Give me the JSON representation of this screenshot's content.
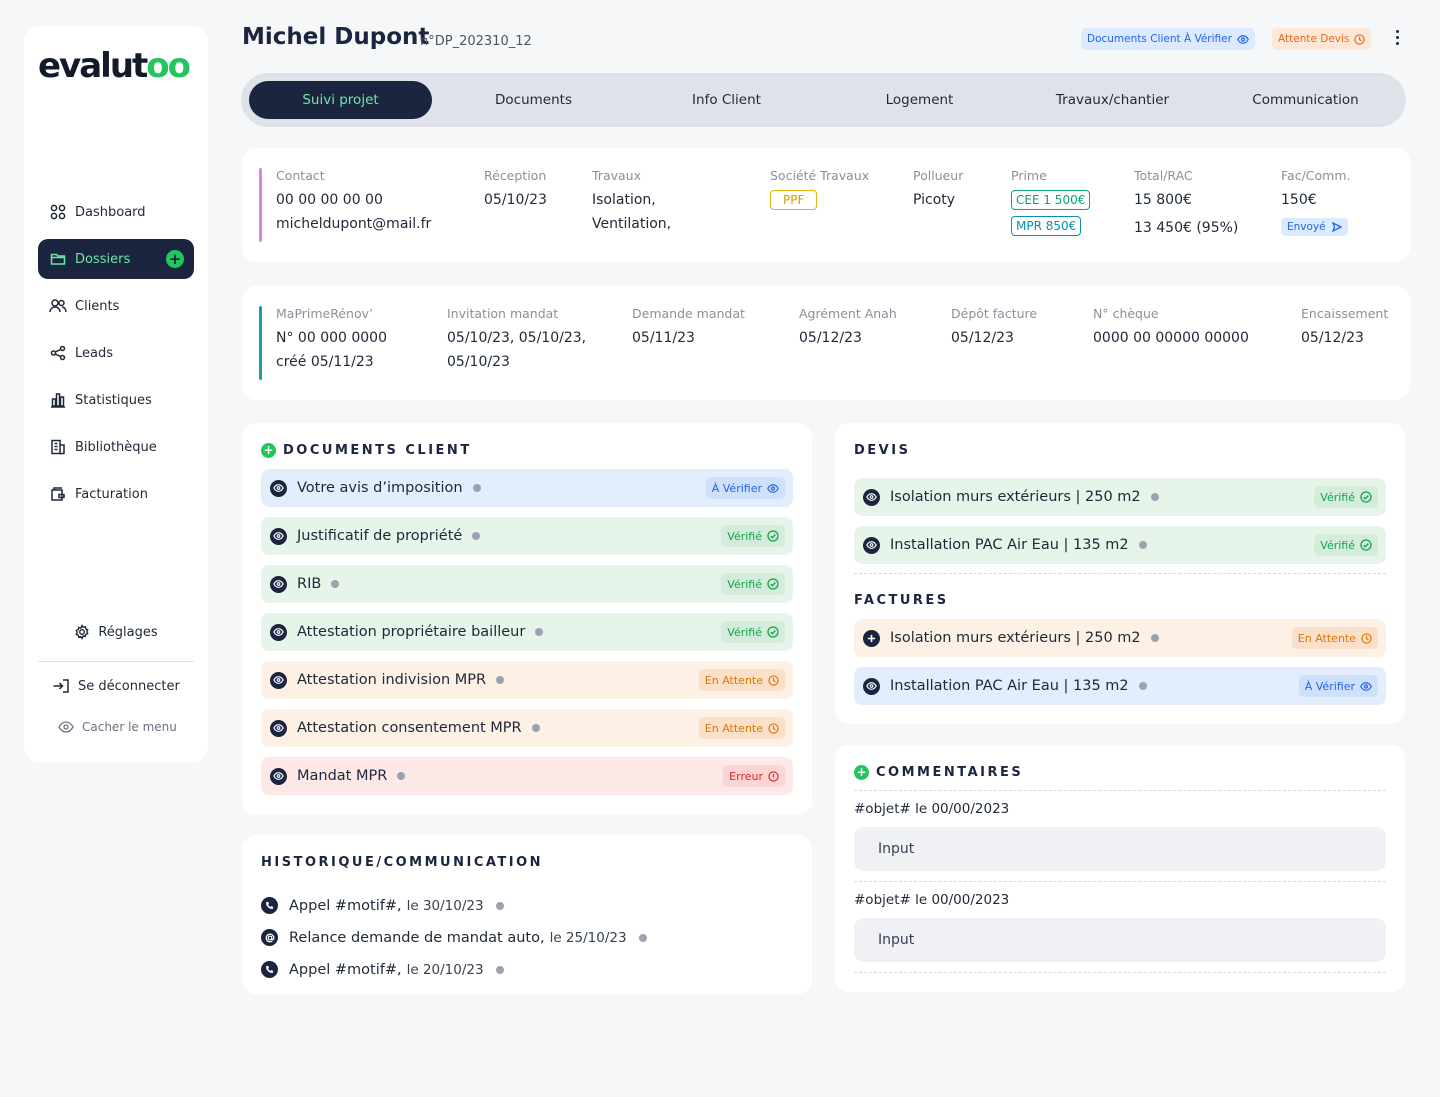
{
  "sidebar": {
    "logo_main": "evalut",
    "logo_accent": "oo",
    "items": [
      {
        "label": "Dashboard",
        "icon": "grid-icon"
      },
      {
        "label": "Dossiers",
        "icon": "folder-icon"
      },
      {
        "label": "Clients",
        "icon": "users-icon"
      },
      {
        "label": "Leads",
        "icon": "share-icon"
      },
      {
        "label": "Statistiques",
        "icon": "bar-chart-icon"
      },
      {
        "label": "Bibliothèque",
        "icon": "building-icon"
      },
      {
        "label": "Facturation",
        "icon": "wallet-icon"
      }
    ],
    "settings": "Réglages",
    "logout": "Se déconnecter",
    "hide_menu": "Cacher le menu"
  },
  "header": {
    "client_name": "Michel Dupont",
    "client_ref": "n°DP_202310_12",
    "badge_documents": "Documents Client À Vérifier",
    "badge_devis": "Attente Devis"
  },
  "tabs": [
    "Suivi projet",
    "Documents",
    "Info Client",
    "Logement",
    "Travaux/chantier",
    "Communication"
  ],
  "info1": {
    "contact_label": "Contact",
    "contact_phone": "00 00 00 00 00",
    "contact_email": "micheldupont@mail.fr",
    "reception_label": "Réception",
    "reception_value": "05/10/23",
    "travaux_label": "Travaux",
    "travaux_line1": "Isolation,",
    "travaux_line2": "Ventilation,",
    "societe_label": "Société Travaux",
    "societe_value": "PPF",
    "pollueur_label": "Pollueur",
    "pollueur_value": "Picoty",
    "prime_label": "Prime",
    "prime_cee": "CEE 1 500€",
    "prime_mpr": "MPR 850€",
    "total_label": "Total/RAC",
    "total_value": "15 800€",
    "rac_value": "13 450€ (95%)",
    "fac_label": "Fac/Comm.",
    "fac_value": "150€",
    "fac_status": "Envoyé"
  },
  "info2": {
    "mpr_label": "MaPrimeRénov’",
    "mpr_number": "N° 00 000 0000",
    "mpr_created": "créé 05/11/23",
    "invitation_label": "Invitation mandat",
    "invitation_line1": "05/10/23, 05/10/23,",
    "invitation_line2": "05/10/23",
    "demande_label": "Demande mandat",
    "demande_value": "05/11/23",
    "agrement_label": "Agrément Anah",
    "agrement_value": "05/12/23",
    "depot_label": "Dépôt facture",
    "depot_value": "05/12/23",
    "cheque_label": "N° chèque",
    "cheque_value": "0000 00 00000 00000",
    "encaissement_label": "Encaissement",
    "encaissement_value": "05/12/23"
  },
  "documents": {
    "title": "DOCUMENTS CLIENT",
    "rows": [
      {
        "label": "Votre avis d’imposition",
        "status": "À Vérifier",
        "kind": "blue"
      },
      {
        "label": "Justificatif de propriété",
        "status": "Vérifié",
        "kind": "green"
      },
      {
        "label": "RIB",
        "status": "Vérifié",
        "kind": "green"
      },
      {
        "label": "Attestation propriétaire bailleur",
        "status": "Vérifié",
        "kind": "green"
      },
      {
        "label": "Attestation indivision MPR",
        "status": "En Attente",
        "kind": "orange"
      },
      {
        "label": "Attestation consentement MPR",
        "status": "En Attente",
        "kind": "orange"
      },
      {
        "label": "Mandat MPR",
        "status": "Erreur",
        "kind": "red"
      }
    ]
  },
  "devis": {
    "title": "DEVIS",
    "rows": [
      {
        "label": "Isolation murs extérieurs | 250 m2",
        "status": "Vérifié",
        "kind": "green"
      },
      {
        "label": "Installation PAC Air Eau | 135 m2",
        "status": "Vérifié",
        "kind": "green"
      }
    ]
  },
  "factures": {
    "title": "FACTURES",
    "rows": [
      {
        "label": "Isolation murs extérieurs | 250 m2",
        "status": "En Attente",
        "kind": "orange"
      },
      {
        "label": "Installation PAC Air Eau | 135 m2",
        "status": "À Vérifier",
        "kind": "blue"
      }
    ]
  },
  "historique": {
    "title": "HISTORIQUE/COMMUNICATION",
    "items": [
      {
        "label": "Appel #motif#,",
        "date": "le 30/10/23",
        "icon": "phone-icon"
      },
      {
        "label": "Relance demande de mandat auto,",
        "date": "le 25/10/23",
        "icon": "at-icon"
      },
      {
        "label": "Appel #motif#,",
        "date": "le 20/10/23",
        "icon": "phone-icon"
      }
    ]
  },
  "commentaires": {
    "title": "COMMENTAIRES",
    "items": [
      {
        "object": "#objet# le 00/00/2023",
        "input": "Input"
      },
      {
        "object": "#objet# le 00/00/2023",
        "input": "Input"
      }
    ]
  }
}
